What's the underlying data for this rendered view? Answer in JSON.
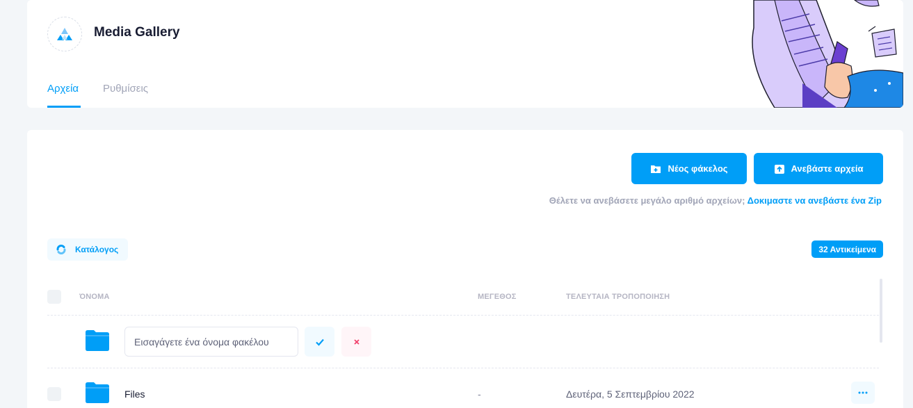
{
  "app": {
    "title": "Media Gallery"
  },
  "tabs": [
    {
      "label": "Αρχεία",
      "active": true
    },
    {
      "label": "Ρυθμίσεις",
      "active": false
    }
  ],
  "toolbar": {
    "new_folder_label": "Νέος φάκελος",
    "upload_label": "Ανεβάστε αρχεία"
  },
  "hint": {
    "text": "Θέλετε να ανεβάσετε μεγάλο αριθμό αρχείων;",
    "link_text": "Δοκιμαστε να ανεβάστε ένα Zip"
  },
  "breadcrumb": {
    "label": "Κατάλογος"
  },
  "item_count": {
    "label": "32 Αντικείμενα"
  },
  "table": {
    "headers": {
      "name": "ΌΝΟΜΑ",
      "size": "ΜΕΓΕΘΟΣ",
      "modified": "ΤΕΛΕΥΤΑΙΑ ΤΡΟΠΟΠΟΙΗΣΗ"
    },
    "new_folder": {
      "placeholder": "Εισαγάγετε ένα όνομα φακέλου",
      "value": ""
    },
    "rows": [
      {
        "name": "Files",
        "size": "-",
        "modified": "Δευτέρα, 5 Σεπτεμβρίου 2022"
      }
    ]
  },
  "colors": {
    "accent": "#009ef7",
    "danger": "#f1416c",
    "muted": "#a1a5b7"
  }
}
